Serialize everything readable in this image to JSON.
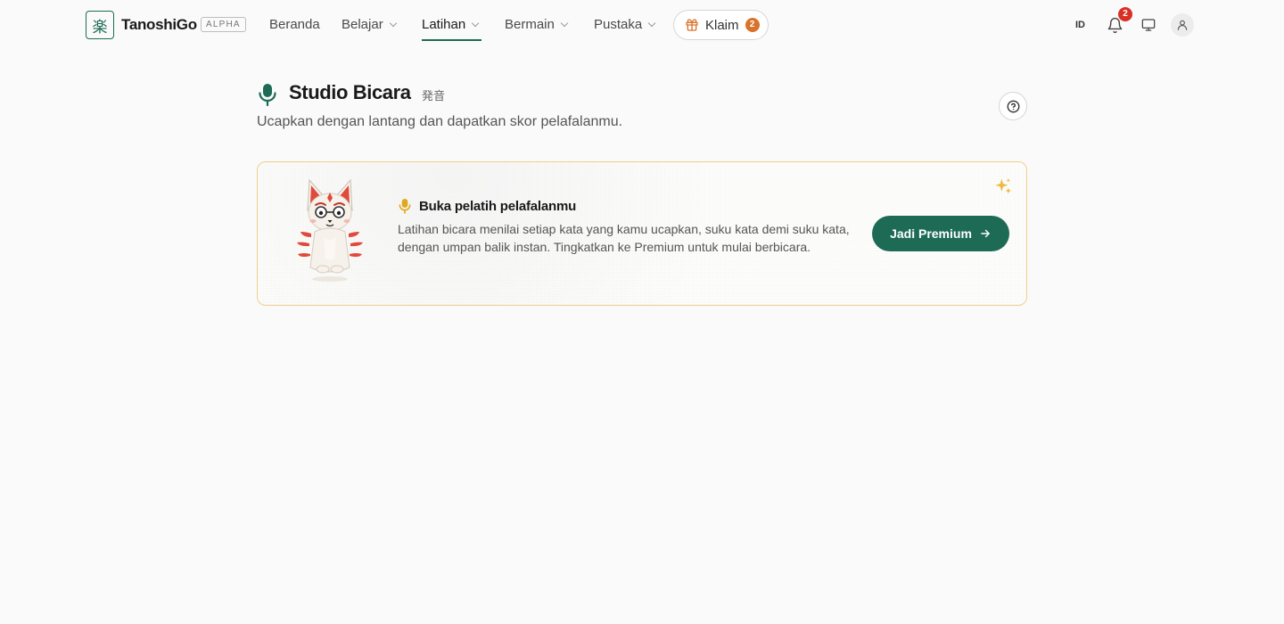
{
  "nav": {
    "logo_glyph": "楽",
    "brand": "TanoshiGo",
    "badge": "ALPHA",
    "items": [
      {
        "label": "Beranda",
        "dropdown": false
      },
      {
        "label": "Belajar",
        "dropdown": true
      },
      {
        "label": "Latihan",
        "dropdown": true,
        "active": true
      },
      {
        "label": "Bermain",
        "dropdown": true
      },
      {
        "label": "Pustaka",
        "dropdown": true
      }
    ],
    "claim": {
      "label": "Klaim",
      "count": "2"
    },
    "language": "ID",
    "notification_count": "2",
    "icons": [
      "bell-icon",
      "monitor-icon",
      "user-icon"
    ]
  },
  "page": {
    "title": "Studio Bicara",
    "title_jp": "発音",
    "subtitle": "Ucapkan dengan lantang dan dapatkan skor pelafalanmu."
  },
  "card": {
    "title": "Buka pelatih pelafalanmu",
    "body": "Latihan bicara menilai setiap kata yang kamu ucapkan, suku kata demi suku kata, dengan umpan balik instan. Tingkatkan ke Premium untuk mulai berbicara.",
    "button_label": "Jadi Premium"
  },
  "colors": {
    "brand_green": "#1e6b55",
    "claim_badge": "#d9722a",
    "notification_badge": "#d93025",
    "card_border": "#f1d08a",
    "mic_yellow": "#e0a81c"
  }
}
